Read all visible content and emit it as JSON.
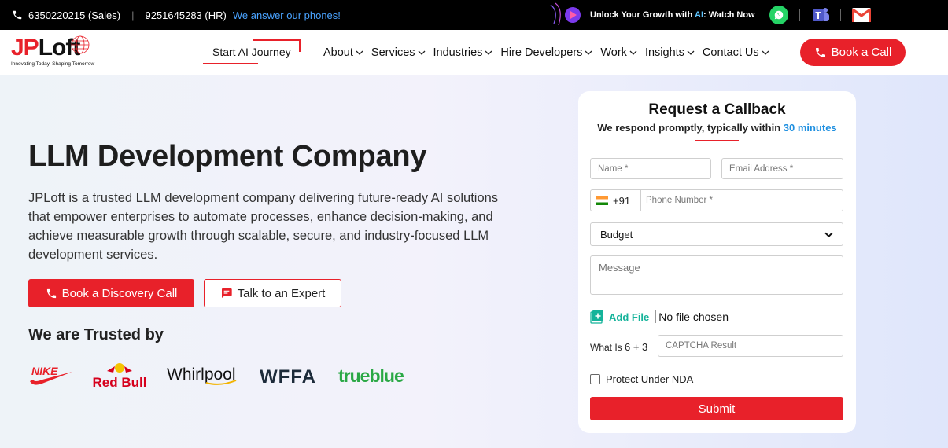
{
  "topbar": {
    "sales_phone": "6350220215 (Sales)",
    "hr_phone": "9251645283 (HR)",
    "answer_text": "We answer our phones!",
    "growth_prefix": "Unlock Your Growth with ",
    "growth_ai": "AI",
    "growth_suffix": ": Watch Now"
  },
  "header": {
    "logo_jp": "JP",
    "logo_loft": "Loft",
    "logo_tagline": "Innovating Today, Shaping Tomorrow",
    "ai_journey": "Start AI Journey",
    "nav": [
      {
        "label": "About"
      },
      {
        "label": "Services"
      },
      {
        "label": "Industries"
      },
      {
        "label": "Hire Developers"
      },
      {
        "label": "Work"
      },
      {
        "label": "Insights"
      },
      {
        "label": "Contact Us"
      }
    ],
    "book_call": "Book a Call"
  },
  "hero": {
    "title": "LLM Development Company",
    "description": "JPLoft is a trusted LLM development company delivering future-ready AI solutions that empower enterprises to automate processes, enhance decision-making, and achieve measurable growth through scalable, secure, and industry-focused LLM development services.",
    "cta_primary": "Book a Discovery Call",
    "cta_secondary": "Talk to an Expert",
    "trusted_heading": "We are Trusted by",
    "clients": [
      "NIKE",
      "Red Bull",
      "Whirlpool",
      "WFFA",
      "trueblue"
    ]
  },
  "form": {
    "title": "Request a Callback",
    "subtitle_prefix": "We respond promptly, typically within ",
    "subtitle_highlight": "30 minutes",
    "name_placeholder": "Name *",
    "email_placeholder": "Email Address *",
    "country_code": "+91",
    "phone_placeholder": "Phone Number *",
    "budget_selected": "Budget",
    "message_placeholder": "Message",
    "add_file_label": "Add File",
    "no_file_text": "No file chosen",
    "captcha_prefix": "What Is ",
    "captcha_sum": "6 + 3",
    "captcha_placeholder": "CAPTCHA Result",
    "nda_label": "Protect Under NDA",
    "submit_label": "Submit"
  },
  "colors": {
    "brand_red": "#e8212a",
    "highlight_blue": "#1e8fe0",
    "accent_teal": "#14b39a"
  }
}
